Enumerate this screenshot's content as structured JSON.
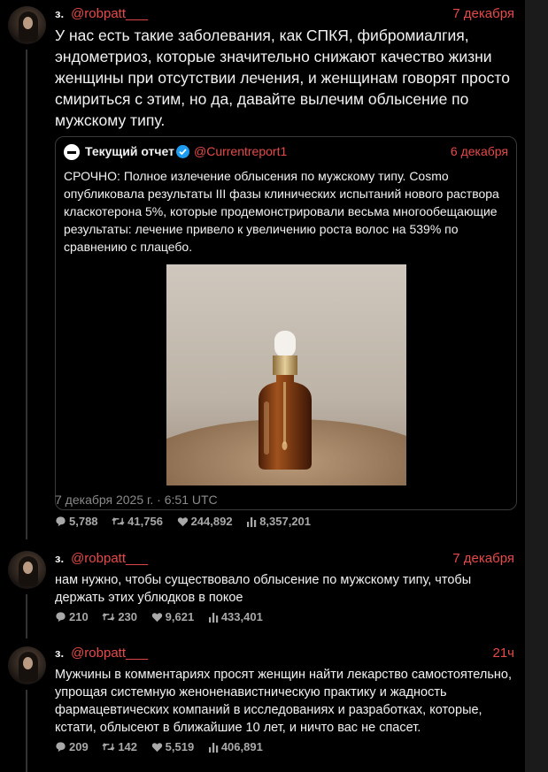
{
  "tweets": [
    {
      "author_name": "з.",
      "handle": "@robpatt___",
      "date": "7 декабря",
      "text": "У нас есть такие заболевания, как СПКЯ, фибромиалгия, эндометриоз, которые значительно снижают качество жизни женщины при отсутствии лечения, и женщинам говорят просто смириться с этим, но да, давайте вылечим облысение по мужскому типу.",
      "timestamp": "7 декабря 2025 г. · 6:51 UTC",
      "stats": {
        "replies": "5,788",
        "retweets": "41,756",
        "likes": "244,892",
        "views": "8,357,201"
      },
      "quote": {
        "author_name": "Текущий отчет",
        "handle": "@Currentreport1",
        "date": "6 декабря",
        "text": "СРОЧНО: Полное излечение облысения по мужскому типу. Cosmo опубликовала результаты III фазы клинических испытаний нового раствора クласкотерона 5%, которые продемонстрировали весьма многообещающие результаты: лечение привело к увеличению роста волос на 539% по сравнению с плацебо.",
        "image_icon": "dropper-bottle-photo"
      }
    },
    {
      "author_name": "з.",
      "handle": "@robpatt___",
      "date": "7 декабря",
      "text": "нам нужно, чтобы существовало облысение по мужскому типу, чтобы держать этих ублюдков в покое",
      "stats": {
        "replies": "210",
        "retweets": "230",
        "likes": "9,621",
        "views": "433,401"
      }
    },
    {
      "author_name": "з.",
      "handle": "@robpatt___",
      "date": "21ч",
      "text": "Мужчины в комментариях просят женщин найти лекарство самостоятельно, упрощая системную женоненавистническую практику и жадность фармацевтических компаний в исследованиях и разработках, которые, кстати, облысеют в ближайшие 10 лет, и ничто вас не спасет.",
      "stats": {
        "replies": "209",
        "retweets": "142",
        "likes": "5,519",
        "views": "406,891"
      }
    }
  ],
  "colors": {
    "accent": "#e64a4a",
    "background": "#000000",
    "muted": "#a8a8a8",
    "verified": "#1d9bf0"
  },
  "icons": {
    "replies": "reply-icon",
    "retweets": "retweet-icon",
    "likes": "heart-icon",
    "views": "views-icon"
  }
}
